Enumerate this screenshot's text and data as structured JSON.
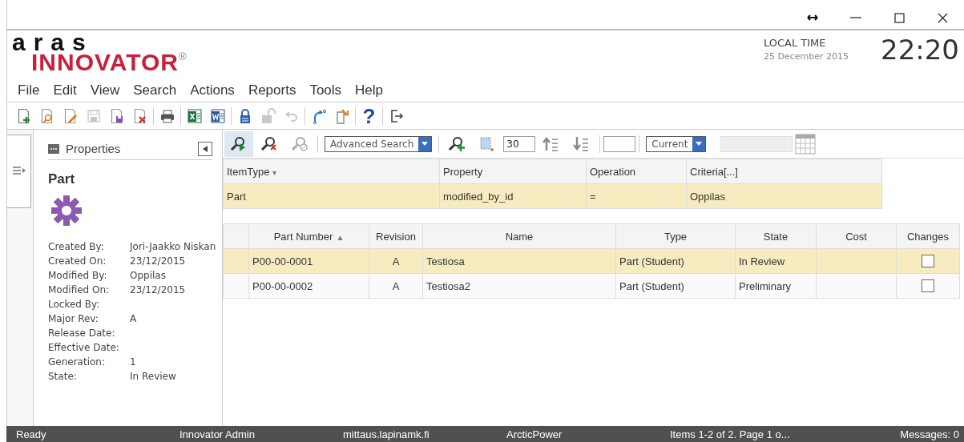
{
  "header": {
    "logo_top": "aras",
    "logo_main": "INNOVATOR",
    "logo_mark": "®",
    "time_label": "LOCAL TIME",
    "date": "25 December 2015",
    "time": "22:20"
  },
  "menu": [
    "File",
    "Edit",
    "View",
    "Search",
    "Actions",
    "Reports",
    "Tools",
    "Help"
  ],
  "toolbar": [
    {
      "kind": "new",
      "disabled": false
    },
    {
      "kind": "view",
      "disabled": false
    },
    {
      "kind": "edit",
      "disabled": false
    },
    {
      "kind": "save",
      "disabled": true
    },
    {
      "kind": "saveclose",
      "disabled": false
    },
    {
      "kind": "delete",
      "disabled": false
    },
    {
      "kind": "separator"
    },
    {
      "kind": "print",
      "disabled": false
    },
    {
      "kind": "separator"
    },
    {
      "kind": "sheet",
      "disabled": false
    },
    {
      "kind": "doc",
      "disabled": false
    },
    {
      "kind": "separator"
    },
    {
      "kind": "lock",
      "disabled": false
    },
    {
      "kind": "unlock",
      "disabled": true
    },
    {
      "kind": "undo",
      "disabled": true
    },
    {
      "kind": "separator"
    },
    {
      "kind": "promote",
      "disabled": false
    },
    {
      "kind": "export",
      "disabled": false
    },
    {
      "kind": "separator"
    },
    {
      "kind": "help",
      "glyph": "?",
      "disabled": false
    },
    {
      "kind": "separator"
    },
    {
      "kind": "exit",
      "disabled": false
    }
  ],
  "properties": {
    "title": "Properties",
    "item_type": "Part",
    "fields": [
      {
        "label": "Created By:",
        "value": "Jori-Jaakko Niskan"
      },
      {
        "label": "Created On:",
        "value": "23/12/2015"
      },
      {
        "label": "Modified By:",
        "value": "Oppilas"
      },
      {
        "label": "Modified On:",
        "value": "23/12/2015"
      },
      {
        "label": "Locked By:"
      },
      {
        "label": "Major Rev:",
        "value": "A"
      },
      {
        "label": "Release Date:"
      },
      {
        "label": "Effective Date:"
      },
      {
        "label": "Generation:",
        "value": "1"
      },
      {
        "label": "State:",
        "value": "In Review"
      }
    ]
  },
  "search_toolbar": [
    {
      "kind": "run",
      "pressed": true
    },
    {
      "kind": "clear",
      "pressed": false
    },
    {
      "kind": "stop",
      "pressed": false
    },
    {
      "kind": "separator"
    },
    {
      "kind": "select",
      "value": "Advanced Search"
    },
    {
      "kind": "separator"
    },
    {
      "kind": "add",
      "pressed": false
    },
    {
      "kind": "pick",
      "pressed": false
    },
    {
      "kind": "field",
      "value": "30"
    },
    {
      "kind": "asc",
      "pressed": false
    },
    {
      "kind": "desc",
      "pressed": false
    },
    {
      "kind": "separator"
    },
    {
      "kind": "field"
    },
    {
      "kind": "separator"
    },
    {
      "kind": "select",
      "value": "Current"
    },
    {
      "kind": "blank"
    },
    {
      "kind": "grid",
      "pressed": false
    }
  ],
  "criteria": {
    "columns": [
      {
        "label": "ItemType",
        "mark": "▾"
      },
      {
        "label": "Property"
      },
      {
        "label": "Operation"
      },
      {
        "label": "Criteria[...]"
      }
    ],
    "rows": [
      {
        "selected": true,
        "cells": [
          "Part",
          "modified_by_id",
          "=",
          "Oppilas"
        ]
      }
    ]
  },
  "results": {
    "columns": [
      {
        "label": "Part Number",
        "mark": "▲"
      },
      {
        "label": "Revision"
      },
      {
        "label": "Name"
      },
      {
        "label": "Type"
      },
      {
        "label": "State"
      },
      {
        "label": "Cost"
      },
      {
        "label": "Changes"
      }
    ],
    "rows": [
      {
        "selected": true,
        "cells": [
          "P00-00-0001",
          "A",
          "Testiosa",
          "Part (Student)",
          "In Review",
          ""
        ],
        "changes": false
      },
      {
        "selected": false,
        "cells": [
          "P00-00-0002",
          "A",
          "Testiosa2",
          "Part (Student)",
          "Preliminary",
          ""
        ],
        "changes": false
      }
    ]
  },
  "status_bar": [
    "Ready",
    "Innovator Admin",
    "mittaus.lapinamk.fi",
    "ArcticPower",
    "Items 1-2 of 2. Page 1 o...",
    "Messages: 0"
  ]
}
